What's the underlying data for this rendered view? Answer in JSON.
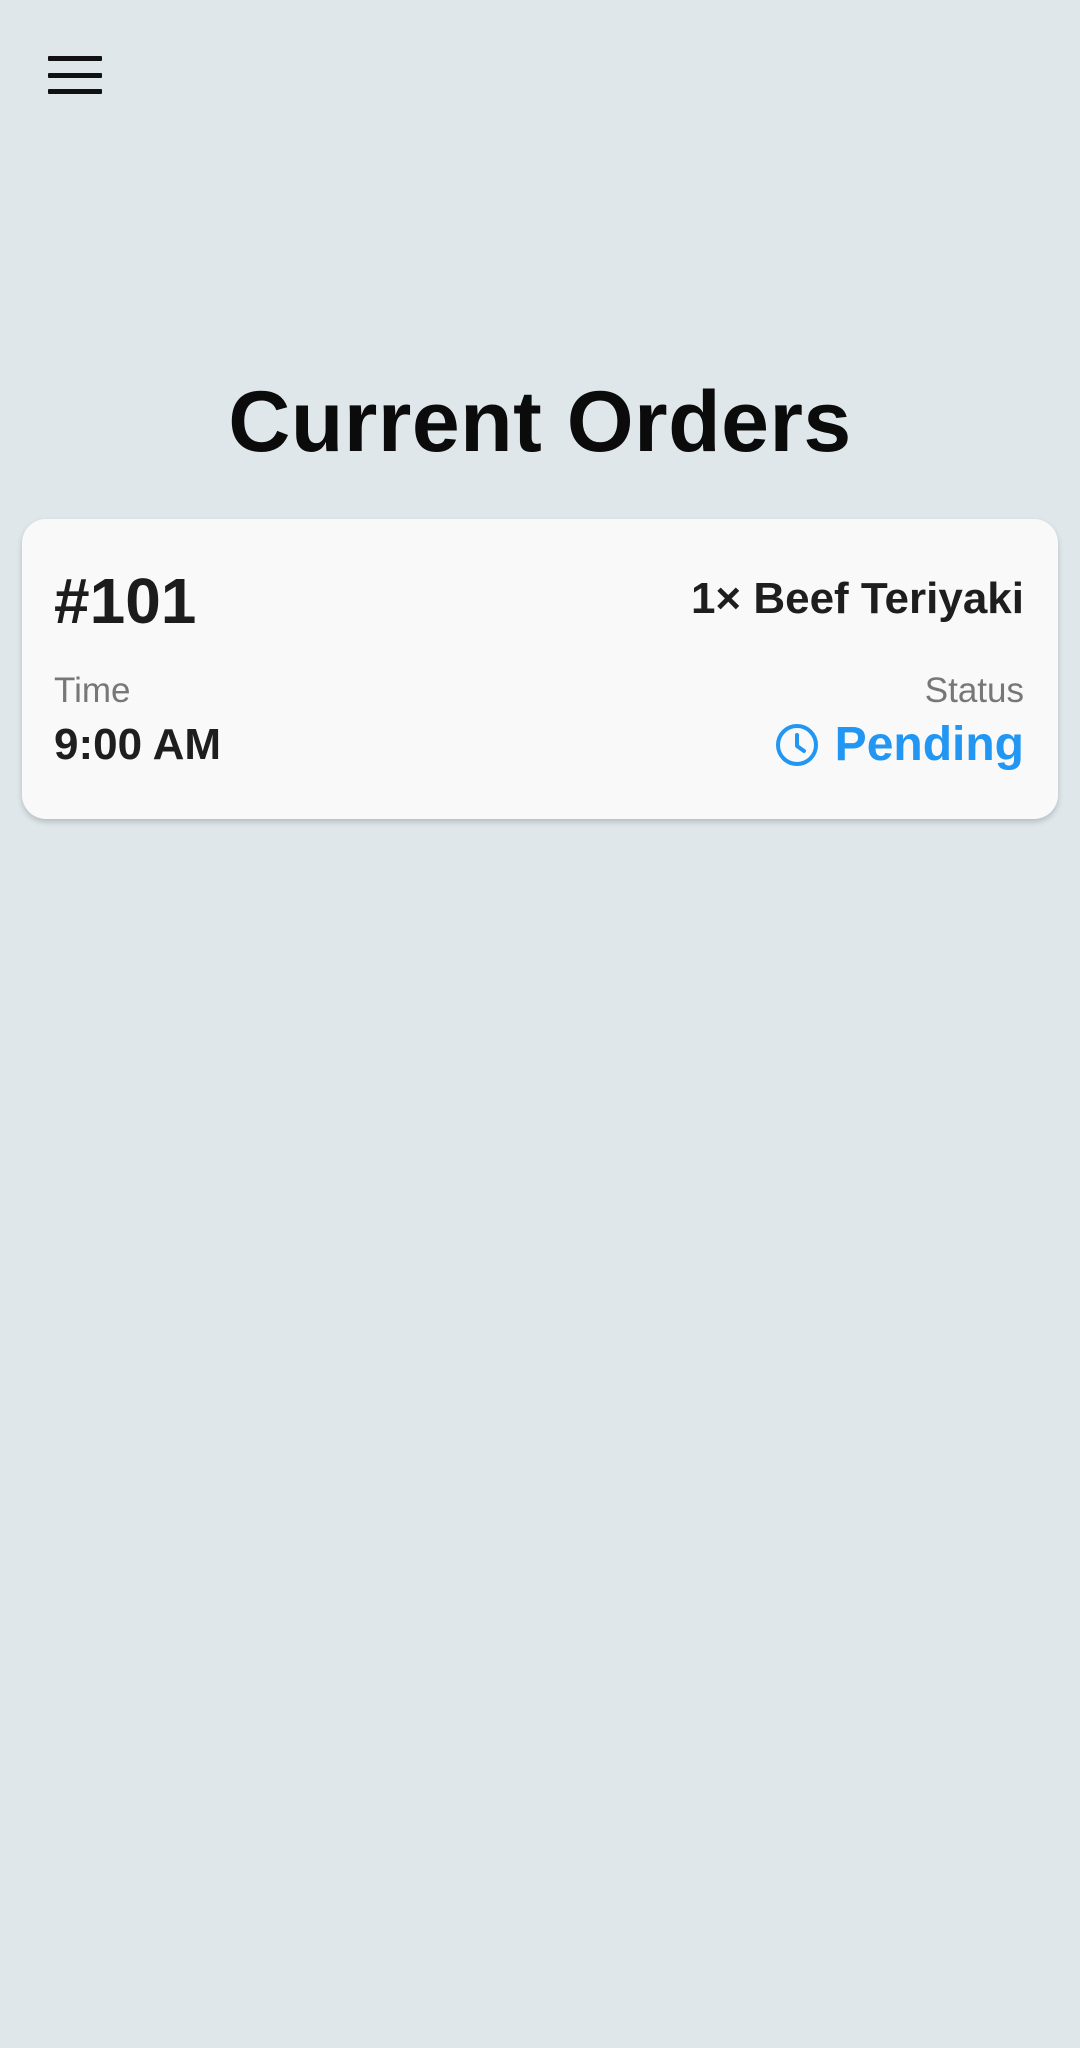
{
  "header": {
    "menu_icon": "hamburger-menu-icon"
  },
  "page": {
    "title": "Current Orders"
  },
  "orders": [
    {
      "number": "#101",
      "items": "1× Beef Teriyaki",
      "time_label": "Time",
      "time": "9:00 AM",
      "status_label": "Status",
      "status": "Pending",
      "status_icon": "clock-icon",
      "status_color": "#2196f3"
    }
  ],
  "colors": {
    "background": "#dfe7eb",
    "card": "#f9f9f9",
    "accent": "#2196f3"
  }
}
